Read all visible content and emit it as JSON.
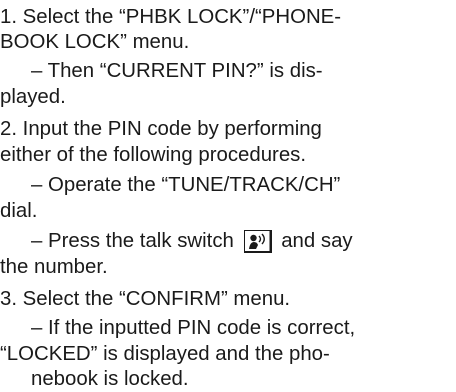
{
  "steps": [
    {
      "lines": [
        "1. Select the “PHBK LOCK”/“PHONE-",
        "BOOK LOCK” menu."
      ],
      "notes": [
        [
          "– Then “CURRENT PIN?” is dis-",
          "played."
        ]
      ]
    },
    {
      "lines": [
        "2. Input the PIN code by performing",
        "either of the following procedures."
      ],
      "notes": [
        [
          "– Operate the “TUNE/TRACK/CH”",
          "dial."
        ],
        [
          "– Press the talk switch",
          "and say",
          "the number."
        ]
      ]
    },
    {
      "lines": [
        "3. Select the “CONFIRM” menu."
      ],
      "notes": [
        [
          "– If the inputted PIN code is correct,",
          "“LOCKED” is displayed and the pho-",
          "nebook is locked."
        ]
      ]
    }
  ],
  "icons": {
    "talk_switch": "talk-switch-icon"
  }
}
